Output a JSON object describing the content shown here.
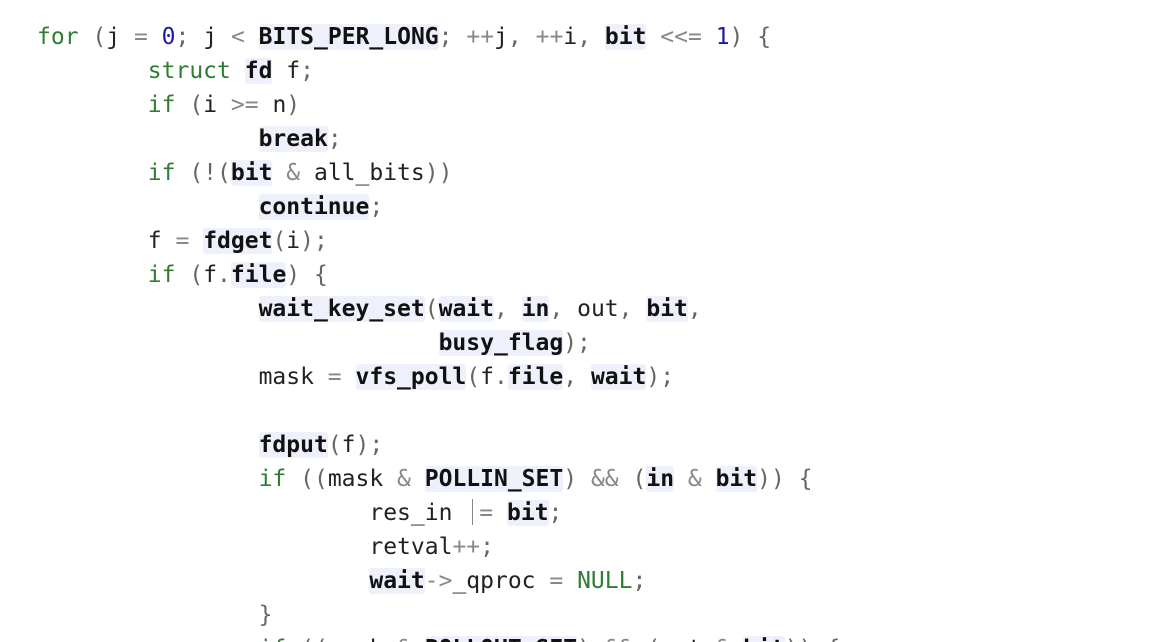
{
  "colors": {
    "keyword": "#2e7d32",
    "number": "#1a1aa6",
    "operator": "#888888",
    "identifier": "#222222",
    "reference_highlight": "#eef0fb",
    "background": "#ffffff"
  },
  "code_lines": [
    [
      {
        "t": "for",
        "c": "kw"
      },
      {
        "t": " ",
        "c": "ident"
      },
      {
        "t": "(",
        "c": "pun"
      },
      {
        "t": "j",
        "c": "ident"
      },
      {
        "t": " = ",
        "c": "op"
      },
      {
        "t": "0",
        "c": "num"
      },
      {
        "t": "; ",
        "c": "pun"
      },
      {
        "t": "j",
        "c": "ident"
      },
      {
        "t": " < ",
        "c": "op"
      },
      {
        "t": "BITS_PER_LONG",
        "c": "ref"
      },
      {
        "t": "; ",
        "c": "pun"
      },
      {
        "t": "++",
        "c": "op"
      },
      {
        "t": "j",
        "c": "ident"
      },
      {
        "t": ", ",
        "c": "pun"
      },
      {
        "t": "++",
        "c": "op"
      },
      {
        "t": "i",
        "c": "ident"
      },
      {
        "t": ", ",
        "c": "pun"
      },
      {
        "t": "bit",
        "c": "ref"
      },
      {
        "t": " <<= ",
        "c": "op"
      },
      {
        "t": "1",
        "c": "num"
      },
      {
        "t": ") {",
        "c": "pun"
      }
    ],
    [
      {
        "t": "        ",
        "c": "ident"
      },
      {
        "t": "struct",
        "c": "kw"
      },
      {
        "t": " ",
        "c": "ident"
      },
      {
        "t": "fd",
        "c": "ref"
      },
      {
        "t": " f",
        "c": "ident"
      },
      {
        "t": ";",
        "c": "pun"
      }
    ],
    [
      {
        "t": "        ",
        "c": "ident"
      },
      {
        "t": "if",
        "c": "kw"
      },
      {
        "t": " (",
        "c": "pun"
      },
      {
        "t": "i",
        "c": "ident"
      },
      {
        "t": " >= ",
        "c": "op"
      },
      {
        "t": "n",
        "c": "ident"
      },
      {
        "t": ")",
        "c": "pun"
      }
    ],
    [
      {
        "t": "                ",
        "c": "ident"
      },
      {
        "t": "break",
        "c": "ref"
      },
      {
        "t": ";",
        "c": "pun"
      }
    ],
    [
      {
        "t": "        ",
        "c": "ident"
      },
      {
        "t": "if",
        "c": "kw"
      },
      {
        "t": " (!(",
        "c": "pun"
      },
      {
        "t": "bit",
        "c": "ref"
      },
      {
        "t": " & ",
        "c": "op"
      },
      {
        "t": "all_bits",
        "c": "ident"
      },
      {
        "t": "))",
        "c": "pun"
      }
    ],
    [
      {
        "t": "                ",
        "c": "ident"
      },
      {
        "t": "continue",
        "c": "ref"
      },
      {
        "t": ";",
        "c": "pun"
      }
    ],
    [
      {
        "t": "        ",
        "c": "ident"
      },
      {
        "t": "f",
        "c": "ident"
      },
      {
        "t": " = ",
        "c": "op"
      },
      {
        "t": "fdget",
        "c": "ref"
      },
      {
        "t": "(",
        "c": "pun"
      },
      {
        "t": "i",
        "c": "ident"
      },
      {
        "t": ");",
        "c": "pun"
      }
    ],
    [
      {
        "t": "        ",
        "c": "ident"
      },
      {
        "t": "if",
        "c": "kw"
      },
      {
        "t": " (",
        "c": "pun"
      },
      {
        "t": "f",
        "c": "ident"
      },
      {
        "t": ".",
        "c": "pun"
      },
      {
        "t": "file",
        "c": "ref"
      },
      {
        "t": ") {",
        "c": "pun"
      }
    ],
    [
      {
        "t": "                ",
        "c": "ident"
      },
      {
        "t": "wait_key_set",
        "c": "ref"
      },
      {
        "t": "(",
        "c": "pun"
      },
      {
        "t": "wait",
        "c": "ref"
      },
      {
        "t": ", ",
        "c": "pun"
      },
      {
        "t": "in",
        "c": "ref"
      },
      {
        "t": ", ",
        "c": "pun"
      },
      {
        "t": "out",
        "c": "ident"
      },
      {
        "t": ", ",
        "c": "pun"
      },
      {
        "t": "bit",
        "c": "ref"
      },
      {
        "t": ",",
        "c": "pun"
      }
    ],
    [
      {
        "t": "                             ",
        "c": "ident"
      },
      {
        "t": "busy_flag",
        "c": "ref"
      },
      {
        "t": ");",
        "c": "pun"
      }
    ],
    [
      {
        "t": "                ",
        "c": "ident"
      },
      {
        "t": "mask",
        "c": "ident"
      },
      {
        "t": " = ",
        "c": "op"
      },
      {
        "t": "vfs_poll",
        "c": "ref"
      },
      {
        "t": "(",
        "c": "pun"
      },
      {
        "t": "f",
        "c": "ident"
      },
      {
        "t": ".",
        "c": "pun"
      },
      {
        "t": "file",
        "c": "ref"
      },
      {
        "t": ", ",
        "c": "pun"
      },
      {
        "t": "wait",
        "c": "ref"
      },
      {
        "t": ");",
        "c": "pun"
      }
    ],
    [],
    [
      {
        "t": "                ",
        "c": "ident"
      },
      {
        "t": "fdput",
        "c": "ref"
      },
      {
        "t": "(",
        "c": "pun"
      },
      {
        "t": "f",
        "c": "ident"
      },
      {
        "t": ");",
        "c": "pun"
      }
    ],
    [
      {
        "t": "                ",
        "c": "ident"
      },
      {
        "t": "if",
        "c": "kw"
      },
      {
        "t": " ((",
        "c": "pun"
      },
      {
        "t": "mask",
        "c": "ident"
      },
      {
        "t": " & ",
        "c": "op"
      },
      {
        "t": "POLLIN_SET",
        "c": "ref"
      },
      {
        "t": ") ",
        "c": "pun"
      },
      {
        "t": "&&",
        "c": "op"
      },
      {
        "t": " (",
        "c": "pun"
      },
      {
        "t": "in",
        "c": "ref"
      },
      {
        "t": " & ",
        "c": "op"
      },
      {
        "t": "bit",
        "c": "ref"
      },
      {
        "t": ")) {",
        "c": "pun"
      }
    ],
    [
      {
        "t": "                        ",
        "c": "ident"
      },
      {
        "t": "res_in",
        "c": "ident"
      },
      {
        "t": " ",
        "c": "ident"
      },
      {
        "t": "",
        "c": "cursor"
      },
      {
        "t": "= ",
        "c": "op"
      },
      {
        "t": "bit",
        "c": "ref"
      },
      {
        "t": ";",
        "c": "pun"
      }
    ],
    [
      {
        "t": "                        ",
        "c": "ident"
      },
      {
        "t": "retval",
        "c": "ident"
      },
      {
        "t": "++",
        "c": "op"
      },
      {
        "t": ";",
        "c": "pun"
      }
    ],
    [
      {
        "t": "                        ",
        "c": "ident"
      },
      {
        "t": "wait",
        "c": "ref"
      },
      {
        "t": "->",
        "c": "op"
      },
      {
        "t": "_qproc",
        "c": "ident"
      },
      {
        "t": " = ",
        "c": "op"
      },
      {
        "t": "NULL",
        "c": "null"
      },
      {
        "t": ";",
        "c": "pun"
      }
    ],
    [
      {
        "t": "                ",
        "c": "ident"
      },
      {
        "t": "}",
        "c": "pun"
      }
    ],
    [
      {
        "t": "                ",
        "c": "ident"
      },
      {
        "t": "if",
        "c": "kw"
      },
      {
        "t": " ((",
        "c": "pun"
      },
      {
        "t": "mask",
        "c": "ident"
      },
      {
        "t": " & ",
        "c": "op"
      },
      {
        "t": "POLLOUT_SET",
        "c": "ref"
      },
      {
        "t": ") ",
        "c": "pun"
      },
      {
        "t": "&&",
        "c": "op"
      },
      {
        "t": " (",
        "c": "pun"
      },
      {
        "t": "out",
        "c": "ident"
      },
      {
        "t": " & ",
        "c": "op"
      },
      {
        "t": "bit",
        "c": "ref"
      },
      {
        "t": ")) {",
        "c": "pun"
      }
    ]
  ]
}
